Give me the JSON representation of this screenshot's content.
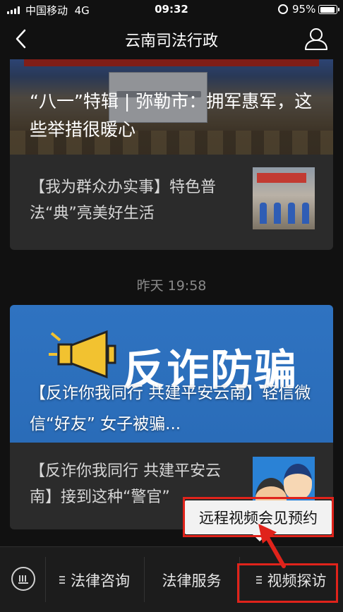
{
  "status_bar": {
    "carrier": "中国移动",
    "network": "4G",
    "time": "09:32",
    "battery_percent": "95%",
    "battery_level": 0.95
  },
  "nav": {
    "title": "云南司法行政"
  },
  "feed": {
    "article1": {
      "headline": "“八一”特辑 | 弥勒市：拥军惠军，这些举措很暖心",
      "sub_item": "【我为群众办实事】特色普法“典”亮美好生活"
    },
    "timestamp": "昨天 19:58",
    "article2": {
      "banner_text": "反诈防骗",
      "headline": "【反诈你我同行 共建平安云南】轻信微信“好友” 女子被骗...",
      "sub_item": "【反诈你我同行 共建平安云南】接到这种“警官”"
    }
  },
  "popup_menu": {
    "item": "远程视频会见预约"
  },
  "tabbar": {
    "tab1": "法律咨询",
    "tab2": "法律服务",
    "tab3": "视频探访"
  },
  "colors": {
    "highlight": "#e0231b",
    "background": "#111111",
    "banner_blue": "#2f73c1"
  },
  "icons": [
    "back-icon",
    "profile-icon",
    "keyboard-icon",
    "menu-icon",
    "megaphone-icon",
    "alarm-icon",
    "battery-icon"
  ]
}
